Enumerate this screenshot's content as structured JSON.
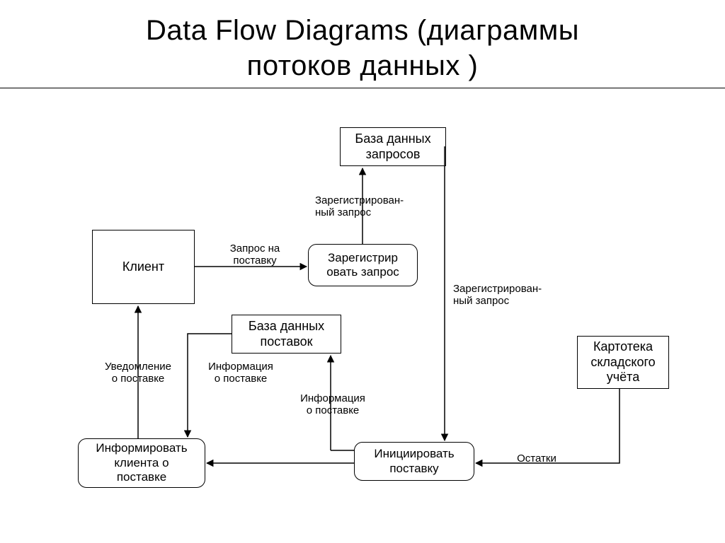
{
  "title_line1": "Data Flow Diagrams (диаграммы",
  "title_line2": "потоков данных )",
  "nodes": {
    "client": "Клиент",
    "db_requests_l1": "База данных",
    "db_requests_l2": "запросов",
    "register_l1": "Зарегистрир",
    "register_l2": "овать запрос",
    "db_supply_l1": "База данных",
    "db_supply_l2": "поставок",
    "inform_l1": "Информировать",
    "inform_l2": "клиента о",
    "inform_l3": "поставке",
    "initiate_l1": "Инициировать",
    "initiate_l2": "поставку",
    "card_l1": "Картотека",
    "card_l2": "складского",
    "card_l3": "учёта"
  },
  "flows": {
    "request_supply_l1": "Запрос на",
    "request_supply_l2": "поставку",
    "registered_l1": "Зарегистрирован-",
    "registered_l2": "ный запрос",
    "registered2_l1": "Зарегистрирован-",
    "registered2_l2": "ный запрос",
    "info_supply_l1": "Информация",
    "info_supply_l2": "о поставке",
    "info_supply2_l1": "Информация",
    "info_supply2_l2": "о поставке",
    "notify_l1": "Уведомление",
    "notify_l2": "о поставке",
    "remainders": "Остатки"
  }
}
